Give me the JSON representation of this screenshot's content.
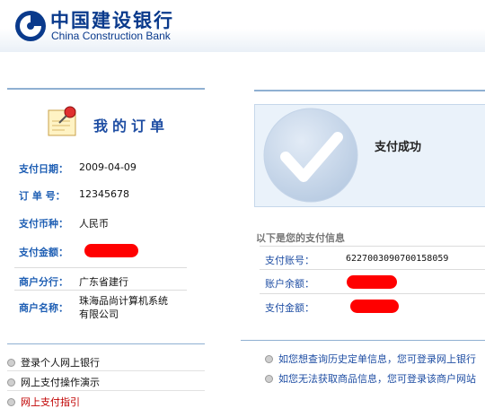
{
  "header": {
    "brand_cn": "中国建设银行",
    "brand_en": "China Construction Bank",
    "logo_icon": "ccb-logo-icon",
    "brand_color": "#0a3a8c"
  },
  "order": {
    "title": "我的订单",
    "icon": "pushpin-note-icon",
    "rows": {
      "date": {
        "label": "支付日期：",
        "value": "2009-04-09"
      },
      "order_no": {
        "label": "订 单 号：",
        "value": "12345678"
      },
      "currency": {
        "label": "支付币种：",
        "value": "人民币"
      },
      "amount": {
        "label": "支付金额：",
        "value": ""
      },
      "branch": {
        "label": "商户分行：",
        "value": "广东省建行"
      },
      "merchant": {
        "label": "商户名称：",
        "value_line1": "珠海品尚计算机系统",
        "value_line2": "有限公司"
      }
    }
  },
  "links": [
    {
      "label": "登录个人网上银行"
    },
    {
      "label": "网上支付操作演示"
    },
    {
      "label": "网上支付指引"
    }
  ],
  "result": {
    "status": "支付成功",
    "icon": "checkmark-circle-icon"
  },
  "payment_info": {
    "title": "以下是您的支付信息",
    "account": {
      "label": "支付账号：",
      "value": "6227003090700158059"
    },
    "balance": {
      "label": "账户余额：",
      "value": ""
    },
    "amount": {
      "label": "支付金额：",
      "value": ""
    }
  },
  "notes": [
    "如您想查询历史定单信息，您可登录网上银行",
    "如您无法获取商品信息，您可登录该商户网站"
  ],
  "colors": {
    "accent_blue": "#1f5fb4",
    "redaction": "#ff0000",
    "highlight_link": "#c00000"
  }
}
